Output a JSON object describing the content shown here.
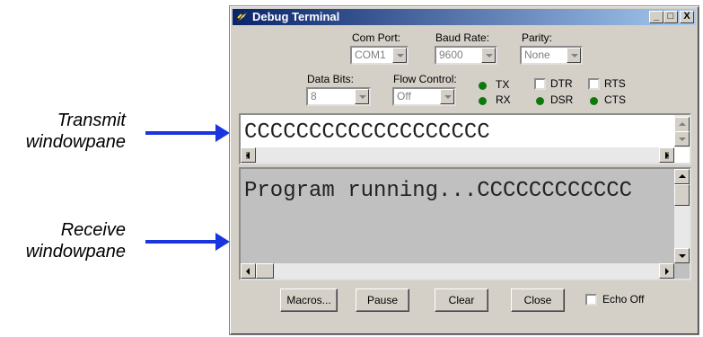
{
  "annotations": {
    "transmit": "Transmit windowpane",
    "receive": "Receive windowpane"
  },
  "window": {
    "title": "Debug Terminal",
    "minimize": "_",
    "maximize": "□",
    "close": "X"
  },
  "settings": {
    "com_port_label": "Com Port:",
    "com_port_value": "COM1",
    "baud_rate_label": "Baud Rate:",
    "baud_rate_value": "9600",
    "parity_label": "Parity:",
    "parity_value": "None",
    "data_bits_label": "Data Bits:",
    "data_bits_value": "8",
    "flow_control_label": "Flow Control:",
    "flow_control_value": "Off"
  },
  "signals": {
    "tx": "TX",
    "rx": "RX",
    "dtr": "DTR",
    "rts": "RTS",
    "dsr": "DSR",
    "cts": "CTS",
    "led_color": "#0b7a0b"
  },
  "transmit_pane": {
    "text": "CCCCCCCCCCCCCCCCCCC"
  },
  "receive_pane": {
    "text": "Program running...CCCCCCCCCCCC"
  },
  "buttons": {
    "macros": "Macros...",
    "pause": "Pause",
    "clear": "Clear",
    "close": "Close",
    "echo_off": "Echo Off"
  },
  "colors": {
    "arrow": "#1a35e0",
    "title_bar_start": "#0a246a",
    "title_bar_end": "#a6caf0"
  }
}
